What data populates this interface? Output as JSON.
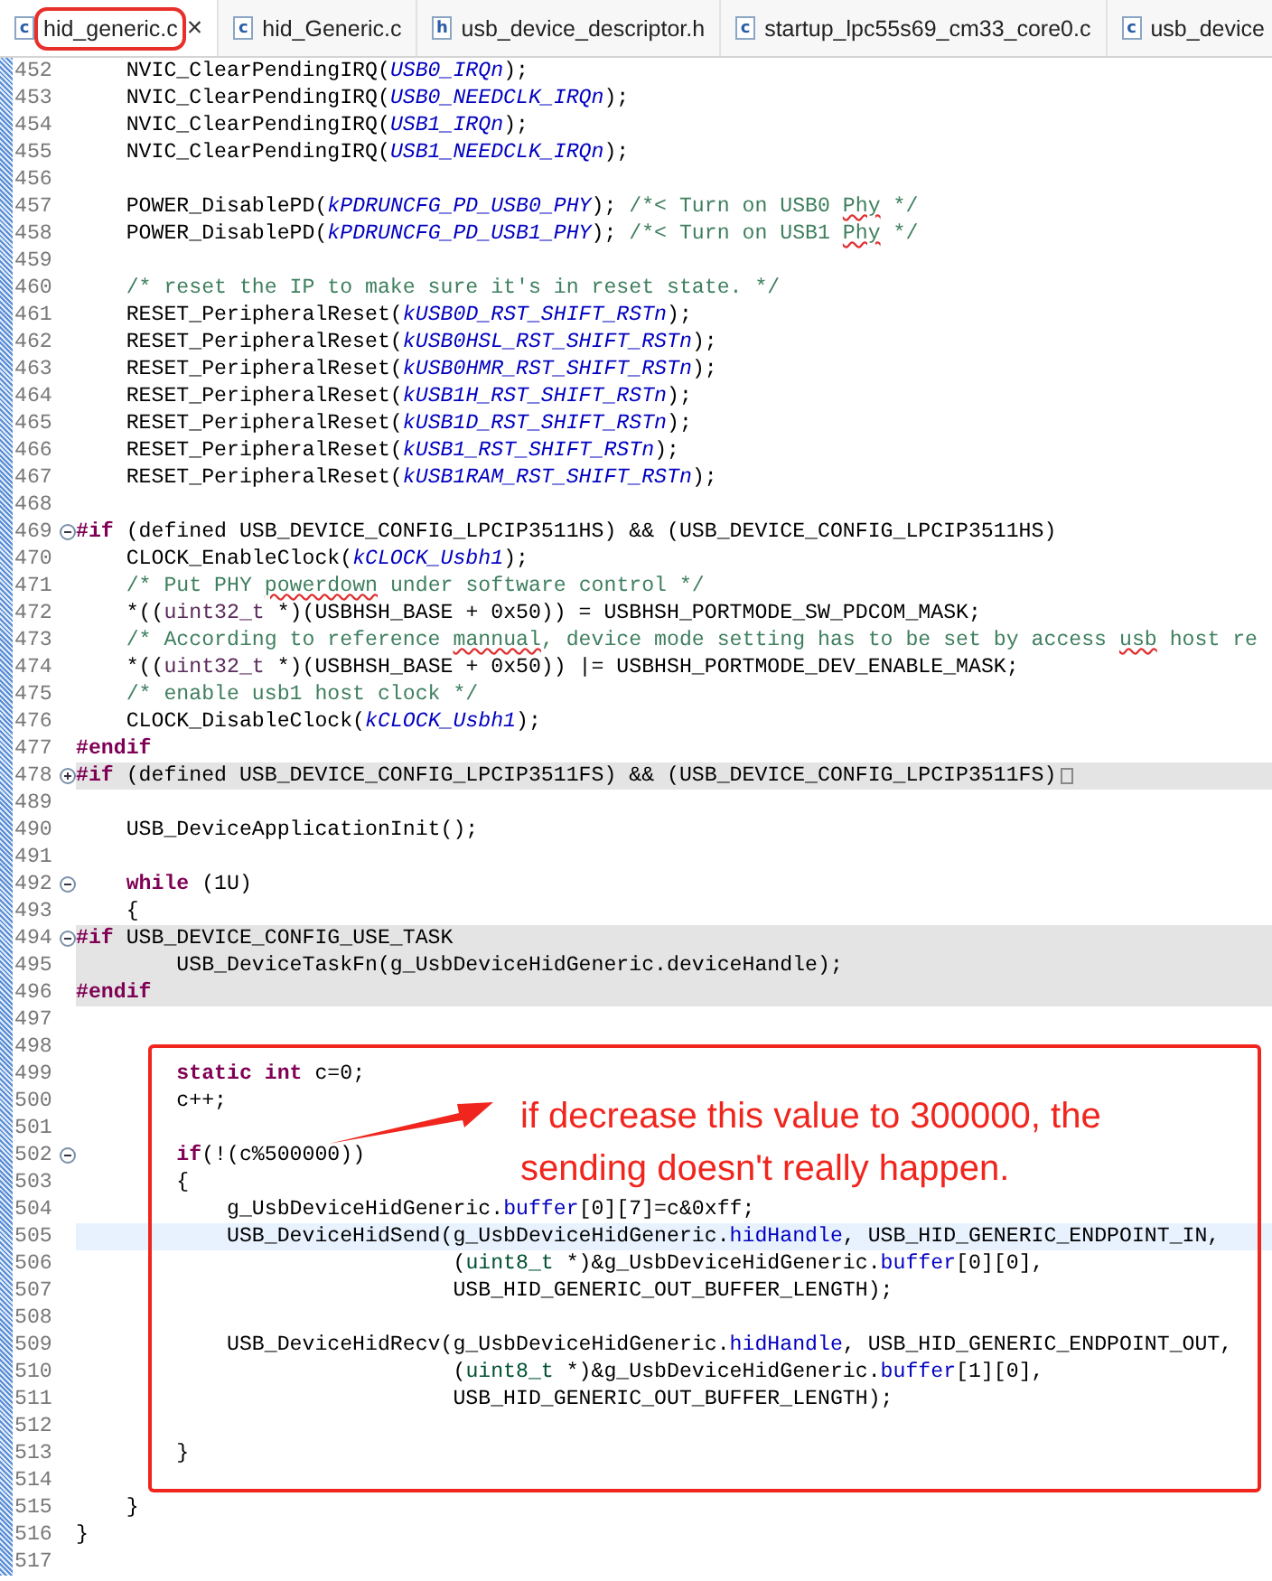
{
  "tabs": [
    {
      "icon_letter": "c",
      "label": "hid_generic.c",
      "selected": true,
      "outlined": true
    },
    {
      "icon_letter": "c",
      "label": "hid_Generic.c",
      "selected": false,
      "outlined": false
    },
    {
      "icon_letter": "h",
      "label": "usb_device_descriptor.h",
      "selected": false,
      "outlined": false
    },
    {
      "icon_letter": "c",
      "label": "startup_lpc55s69_cm33_core0.c",
      "selected": false,
      "outlined": false
    },
    {
      "icon_letter": "c",
      "label": "usb_device",
      "selected": false,
      "outlined": false
    }
  ],
  "close_glyph": "×",
  "lines": [
    {
      "number": "452",
      "tokens": [
        {
          "kind": "plain",
          "text": "    NVIC_ClearPendingIRQ("
        },
        {
          "kind": "constant",
          "text": "USB0_IRQn"
        },
        {
          "kind": "plain",
          "text": ");"
        }
      ]
    },
    {
      "number": "453",
      "tokens": [
        {
          "kind": "plain",
          "text": "    NVIC_ClearPendingIRQ("
        },
        {
          "kind": "constant",
          "text": "USB0_NEEDCLK_IRQn"
        },
        {
          "kind": "plain",
          "text": ");"
        }
      ]
    },
    {
      "number": "454",
      "tokens": [
        {
          "kind": "plain",
          "text": "    NVIC_ClearPendingIRQ("
        },
        {
          "kind": "constant",
          "text": "USB1_IRQn"
        },
        {
          "kind": "plain",
          "text": ");"
        }
      ]
    },
    {
      "number": "455",
      "tokens": [
        {
          "kind": "plain",
          "text": "    NVIC_ClearPendingIRQ("
        },
        {
          "kind": "constant",
          "text": "USB1_NEEDCLK_IRQn"
        },
        {
          "kind": "plain",
          "text": ");"
        }
      ]
    },
    {
      "number": "456"
    },
    {
      "number": "457",
      "tokens": [
        {
          "kind": "plain",
          "text": "    POWER_DisablePD("
        },
        {
          "kind": "constant",
          "text": "kPDRUNCFG_PD_USB0_PHY"
        },
        {
          "kind": "plain",
          "text": "); "
        },
        {
          "kind": "comment",
          "text": "/*< Turn on USB0 "
        },
        {
          "kind": "misspelled",
          "text": "Phy"
        },
        {
          "kind": "comment",
          "text": " */"
        }
      ]
    },
    {
      "number": "458",
      "tokens": [
        {
          "kind": "plain",
          "text": "    POWER_DisablePD("
        },
        {
          "kind": "constant",
          "text": "kPDRUNCFG_PD_USB1_PHY"
        },
        {
          "kind": "plain",
          "text": "); "
        },
        {
          "kind": "comment",
          "text": "/*< Turn on USB1 "
        },
        {
          "kind": "misspelled",
          "text": "Phy"
        },
        {
          "kind": "comment",
          "text": " */"
        }
      ]
    },
    {
      "number": "459"
    },
    {
      "number": "460",
      "tokens": [
        {
          "kind": "comment",
          "text": "    /* reset the IP to make sure it's in reset state. */"
        }
      ]
    },
    {
      "number": "461",
      "tokens": [
        {
          "kind": "plain",
          "text": "    RESET_PeripheralReset("
        },
        {
          "kind": "constant",
          "text": "kUSB0D_RST_SHIFT_RSTn"
        },
        {
          "kind": "plain",
          "text": ");"
        }
      ]
    },
    {
      "number": "462",
      "tokens": [
        {
          "kind": "plain",
          "text": "    RESET_PeripheralReset("
        },
        {
          "kind": "constant",
          "text": "kUSB0HSL_RST_SHIFT_RSTn"
        },
        {
          "kind": "plain",
          "text": ");"
        }
      ]
    },
    {
      "number": "463",
      "tokens": [
        {
          "kind": "plain",
          "text": "    RESET_PeripheralReset("
        },
        {
          "kind": "constant",
          "text": "kUSB0HMR_RST_SHIFT_RSTn"
        },
        {
          "kind": "plain",
          "text": ");"
        }
      ]
    },
    {
      "number": "464",
      "tokens": [
        {
          "kind": "plain",
          "text": "    RESET_PeripheralReset("
        },
        {
          "kind": "constant",
          "text": "kUSB1H_RST_SHIFT_RSTn"
        },
        {
          "kind": "plain",
          "text": ");"
        }
      ]
    },
    {
      "number": "465",
      "tokens": [
        {
          "kind": "plain",
          "text": "    RESET_PeripheralReset("
        },
        {
          "kind": "constant",
          "text": "kUSB1D_RST_SHIFT_RSTn"
        },
        {
          "kind": "plain",
          "text": ");"
        }
      ]
    },
    {
      "number": "466",
      "tokens": [
        {
          "kind": "plain",
          "text": "    RESET_PeripheralReset("
        },
        {
          "kind": "constant",
          "text": "kUSB1_RST_SHIFT_RSTn"
        },
        {
          "kind": "plain",
          "text": ");"
        }
      ]
    },
    {
      "number": "467",
      "tokens": [
        {
          "kind": "plain",
          "text": "    RESET_PeripheralReset("
        },
        {
          "kind": "constant",
          "text": "kUSB1RAM_RST_SHIFT_RSTn"
        },
        {
          "kind": "plain",
          "text": ");"
        }
      ]
    },
    {
      "number": "468"
    },
    {
      "number": "469",
      "foldable": true,
      "folded": false,
      "tokens": [
        {
          "kind": "keyword",
          "text": "#if"
        },
        {
          "kind": "plain",
          "text": " (defined USB_DEVICE_CONFIG_LPCIP3511HS) && (USB_DEVICE_CONFIG_LPCIP3511HS)"
        }
      ]
    },
    {
      "number": "470",
      "tokens": [
        {
          "kind": "plain",
          "text": "    CLOCK_EnableClock("
        },
        {
          "kind": "constant",
          "text": "kCLOCK_Usbh1"
        },
        {
          "kind": "plain",
          "text": ");"
        }
      ]
    },
    {
      "number": "471",
      "tokens": [
        {
          "kind": "comment",
          "text": "    /* Put PHY "
        },
        {
          "kind": "misspelled",
          "text": "powerdown"
        },
        {
          "kind": "comment",
          "text": " under software control */"
        }
      ]
    },
    {
      "number": "472",
      "tokens": [
        {
          "kind": "plain",
          "text": "    *(("
        },
        {
          "kind": "builtin",
          "text": "uint32_t"
        },
        {
          "kind": "plain",
          "text": " *)(USBHSH_BASE + 0x50)) = USBHSH_PORTMODE_SW_PDCOM_MASK;"
        }
      ]
    },
    {
      "number": "473",
      "tokens": [
        {
          "kind": "comment",
          "text": "    /* According to reference "
        },
        {
          "kind": "misspelled",
          "text": "mannual"
        },
        {
          "kind": "comment",
          "text": ", device mode setting has to be set by access "
        },
        {
          "kind": "misspelled",
          "text": "usb"
        },
        {
          "kind": "comment",
          "text": " host re"
        }
      ]
    },
    {
      "number": "474",
      "tokens": [
        {
          "kind": "plain",
          "text": "    *(("
        },
        {
          "kind": "builtin",
          "text": "uint32_t"
        },
        {
          "kind": "plain",
          "text": " *)(USBHSH_BASE + 0x50)) |= USBHSH_PORTMODE_DEV_ENABLE_MASK;"
        }
      ]
    },
    {
      "number": "475",
      "tokens": [
        {
          "kind": "comment",
          "text": "    /* enable usb1 host clock */"
        }
      ]
    },
    {
      "number": "476",
      "tokens": [
        {
          "kind": "plain",
          "text": "    CLOCK_DisableClock("
        },
        {
          "kind": "constant",
          "text": "kCLOCK_Usbh1"
        },
        {
          "kind": "plain",
          "text": ");"
        }
      ]
    },
    {
      "number": "477",
      "tokens": [
        {
          "kind": "keyword",
          "text": "#endif"
        }
      ]
    },
    {
      "number": "478",
      "foldable": true,
      "folded": true,
      "inactive": true,
      "tokens": [
        {
          "kind": "keyword",
          "text": "#if"
        },
        {
          "kind": "plain",
          "text": " (defined USB_DEVICE_CONFIG_LPCIP3511FS) && (USB_DEVICE_CONFIG_LPCIP3511FS)"
        }
      ]
    },
    {
      "number": "489"
    },
    {
      "number": "490",
      "tokens": [
        {
          "kind": "plain",
          "text": "    USB_DeviceApplicationInit();"
        }
      ]
    },
    {
      "number": "491"
    },
    {
      "number": "492",
      "foldable": true,
      "folded": false,
      "tokens": [
        {
          "kind": "keyword",
          "text": "    while"
        },
        {
          "kind": "plain",
          "text": " (1U)"
        }
      ]
    },
    {
      "number": "493",
      "tokens": [
        {
          "kind": "plain",
          "text": "    {"
        }
      ]
    },
    {
      "number": "494",
      "foldable": true,
      "folded": false,
      "inactive": true,
      "tokens": [
        {
          "kind": "keyword",
          "text": "#if"
        },
        {
          "kind": "plain",
          "text": " USB_DEVICE_CONFIG_USE_TASK"
        }
      ]
    },
    {
      "number": "495",
      "inactive": true,
      "tokens": [
        {
          "kind": "plain",
          "text": "        USB_DeviceTaskFn(g_UsbDeviceHidGeneric.deviceHandle);"
        }
      ]
    },
    {
      "number": "496",
      "inactive": true,
      "tokens": [
        {
          "kind": "keyword",
          "text": "#endif"
        }
      ]
    },
    {
      "number": "497"
    },
    {
      "number": "498"
    },
    {
      "number": "499",
      "tokens": [
        {
          "kind": "keyword",
          "text": "        static int"
        },
        {
          "kind": "plain",
          "text": " c=0;"
        }
      ]
    },
    {
      "number": "500",
      "tokens": [
        {
          "kind": "plain",
          "text": "        c++;"
        }
      ]
    },
    {
      "number": "501"
    },
    {
      "number": "502",
      "foldable": true,
      "folded": false,
      "tokens": [
        {
          "kind": "keyword",
          "text": "        if"
        },
        {
          "kind": "plain",
          "text": "(!(c%500000))"
        }
      ]
    },
    {
      "number": "503",
      "tokens": [
        {
          "kind": "plain",
          "text": "        {"
        }
      ]
    },
    {
      "number": "504",
      "tokens": [
        {
          "kind": "plain",
          "text": "            g_UsbDeviceHidGeneric."
        },
        {
          "kind": "field",
          "text": "buffer"
        },
        {
          "kind": "plain",
          "text": "[0][7]=c&0xff;"
        }
      ]
    },
    {
      "number": "505",
      "current": true,
      "tokens": [
        {
          "kind": "plain",
          "text": "            USB_DeviceHidSend(g_UsbDeviceHidGeneric."
        },
        {
          "kind": "field",
          "text": "hidHandle"
        },
        {
          "kind": "plain",
          "text": ", USB_HID_GENERIC_ENDPOINT_IN,"
        }
      ]
    },
    {
      "number": "506",
      "tokens": [
        {
          "kind": "plain",
          "text": "                              ("
        },
        {
          "kind": "typedef",
          "text": "uint8_t"
        },
        {
          "kind": "plain",
          "text": " *)&g_UsbDeviceHidGeneric."
        },
        {
          "kind": "field",
          "text": "buffer"
        },
        {
          "kind": "plain",
          "text": "[0][0],"
        }
      ]
    },
    {
      "number": "507",
      "tokens": [
        {
          "kind": "plain",
          "text": "                              USB_HID_GENERIC_OUT_BUFFER_LENGTH);"
        }
      ]
    },
    {
      "number": "508"
    },
    {
      "number": "509",
      "tokens": [
        {
          "kind": "plain",
          "text": "            USB_DeviceHidRecv(g_UsbDeviceHidGeneric."
        },
        {
          "kind": "field",
          "text": "hidHandle"
        },
        {
          "kind": "plain",
          "text": ", USB_HID_GENERIC_ENDPOINT_OUT,"
        }
      ]
    },
    {
      "number": "510",
      "tokens": [
        {
          "kind": "plain",
          "text": "                              ("
        },
        {
          "kind": "typedef",
          "text": "uint8_t"
        },
        {
          "kind": "plain",
          "text": " *)&g_UsbDeviceHidGeneric."
        },
        {
          "kind": "field",
          "text": "buffer"
        },
        {
          "kind": "plain",
          "text": "[1][0],"
        }
      ]
    },
    {
      "number": "511",
      "tokens": [
        {
          "kind": "plain",
          "text": "                              USB_HID_GENERIC_OUT_BUFFER_LENGTH);"
        }
      ]
    },
    {
      "number": "512"
    },
    {
      "number": "513",
      "tokens": [
        {
          "kind": "plain",
          "text": "        }"
        }
      ]
    },
    {
      "number": "514"
    },
    {
      "number": "515",
      "tokens": [
        {
          "kind": "plain",
          "text": "    }"
        }
      ]
    },
    {
      "number": "516",
      "tokens": [
        {
          "kind": "plain",
          "text": "}"
        }
      ]
    },
    {
      "number": "517"
    }
  ],
  "annotation": {
    "text": "if decrease this value to 300000, the sending doesn't really happen."
  }
}
